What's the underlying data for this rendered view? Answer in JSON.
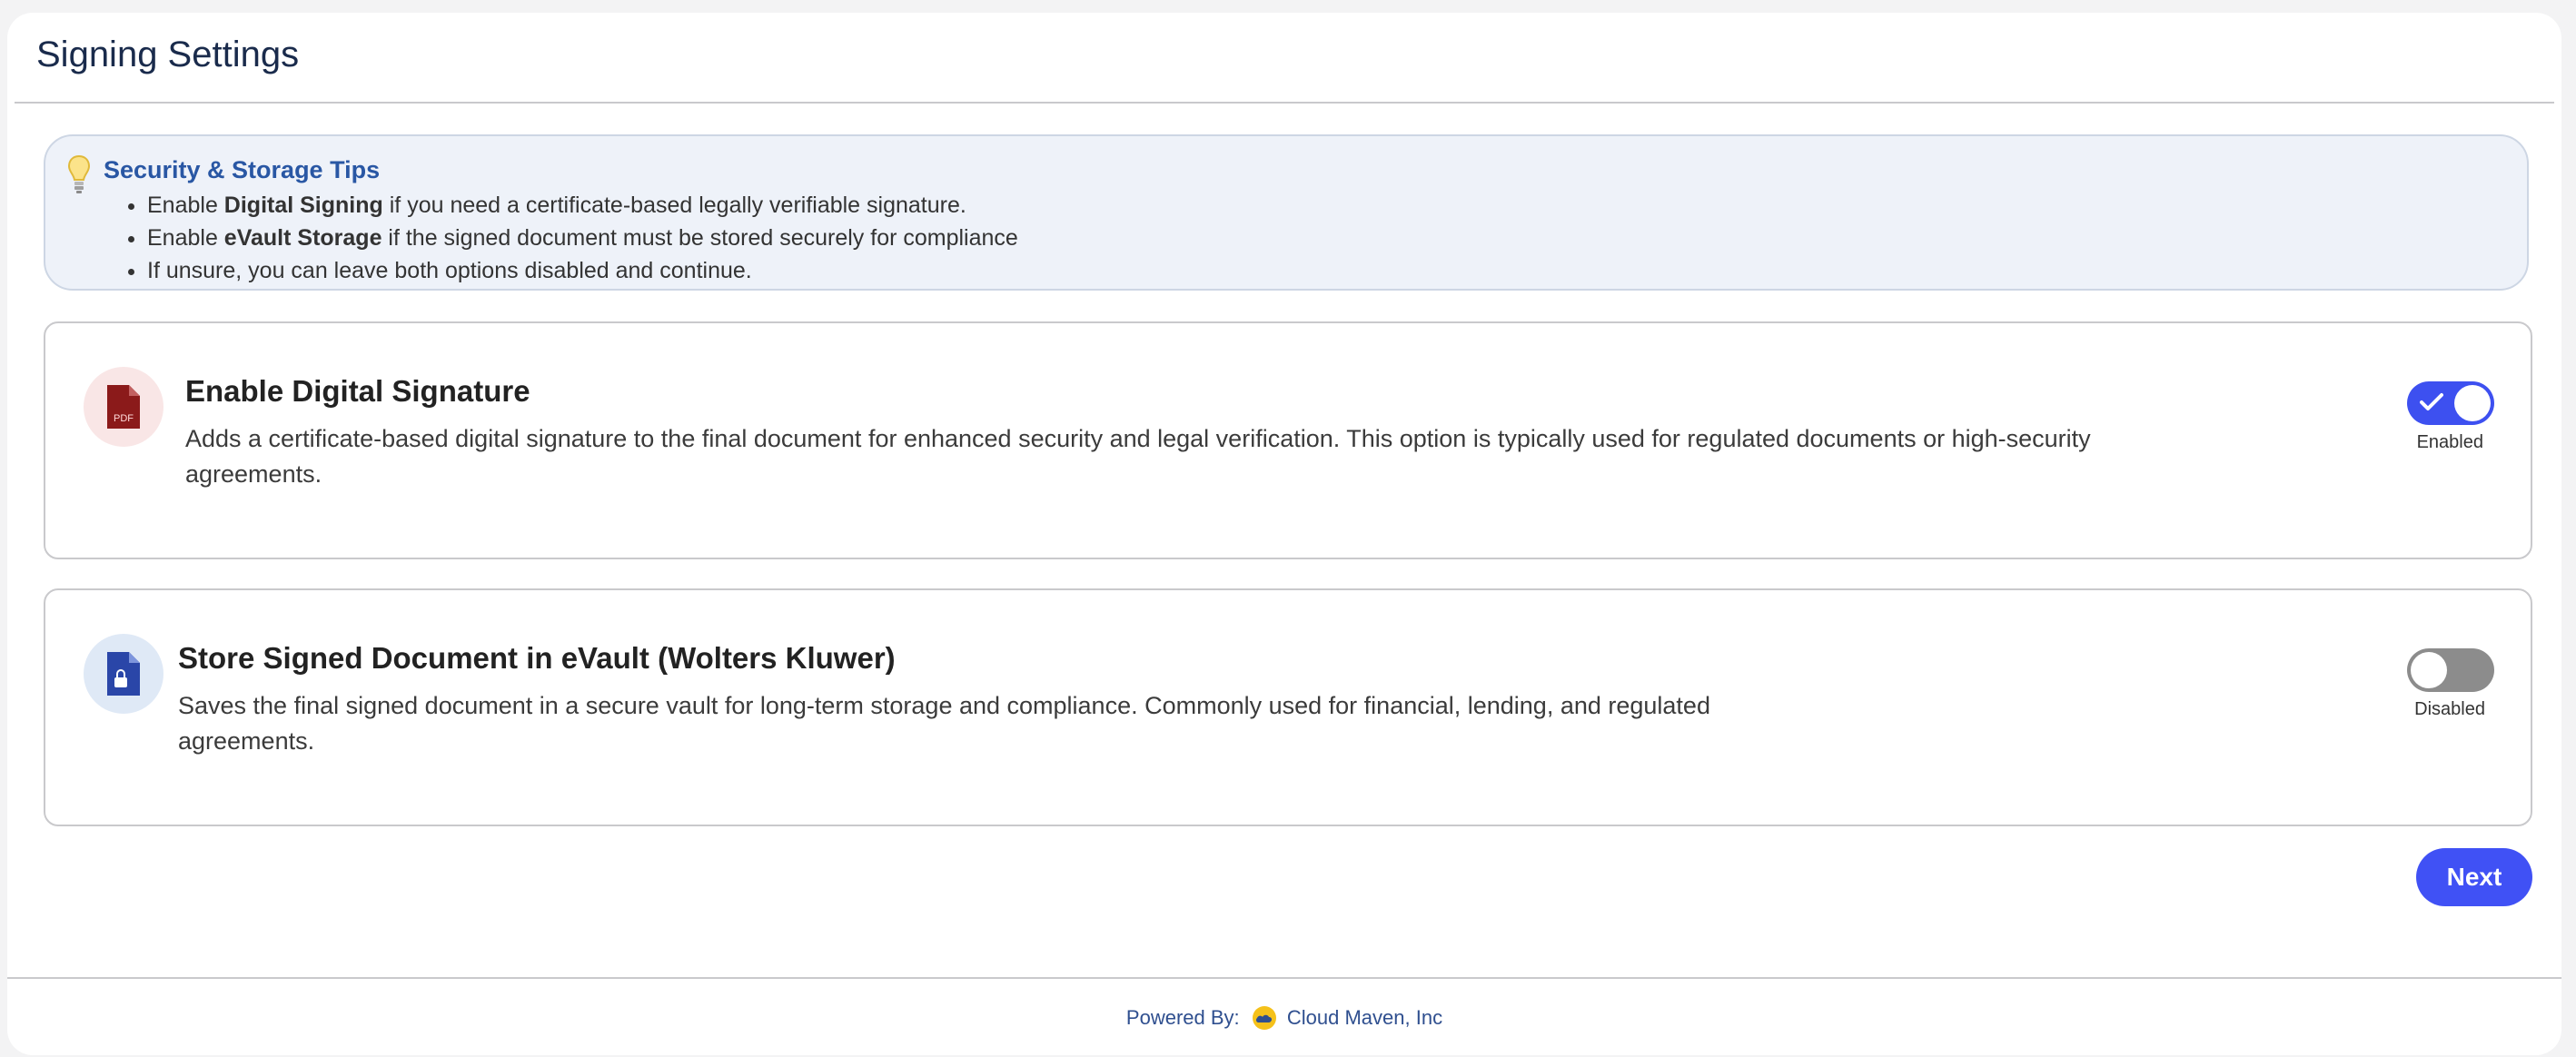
{
  "page": {
    "title": "Signing Settings"
  },
  "tips": {
    "icon": "lightbulb-icon",
    "title": "Security & Storage Tips",
    "items": [
      {
        "prefix": "Enable ",
        "bold": "Digital Signing",
        "suffix": " if you need a certificate-based legally verifiable signature."
      },
      {
        "prefix": "Enable ",
        "bold": "eVault Storage",
        "suffix": " if the signed document must be stored securely for compliance"
      },
      {
        "prefix": "If unsure, you can leave both options disabled and continue.",
        "bold": "",
        "suffix": ""
      }
    ]
  },
  "options": [
    {
      "icon": "pdf-file-icon",
      "title": "Enable Digital Signature",
      "description": "Adds a certificate-based digital signature to the final document for enhanced security and legal verification. This option is typically used for regulated documents or high-security agreements.",
      "enabled": true,
      "status_label": "Enabled"
    },
    {
      "icon": "locked-document-icon",
      "title": "Store Signed Document in eVault (Wolters Kluwer)",
      "description": "Saves the final signed document in a secure vault for long-term storage and compliance. Commonly used for financial, lending, and regulated agreements.",
      "enabled": false,
      "status_label": "Disabled"
    }
  ],
  "actions": {
    "next_label": "Next"
  },
  "footer": {
    "powered_by": "Powered By:",
    "company": "Cloud Maven, Inc",
    "logo_icon": "cloud-maven-logo-icon"
  },
  "colors": {
    "accent": "#4051f5",
    "toggle_off": "#8c8c8c",
    "tips_title": "#2957a4",
    "title": "#1a2b4c"
  }
}
